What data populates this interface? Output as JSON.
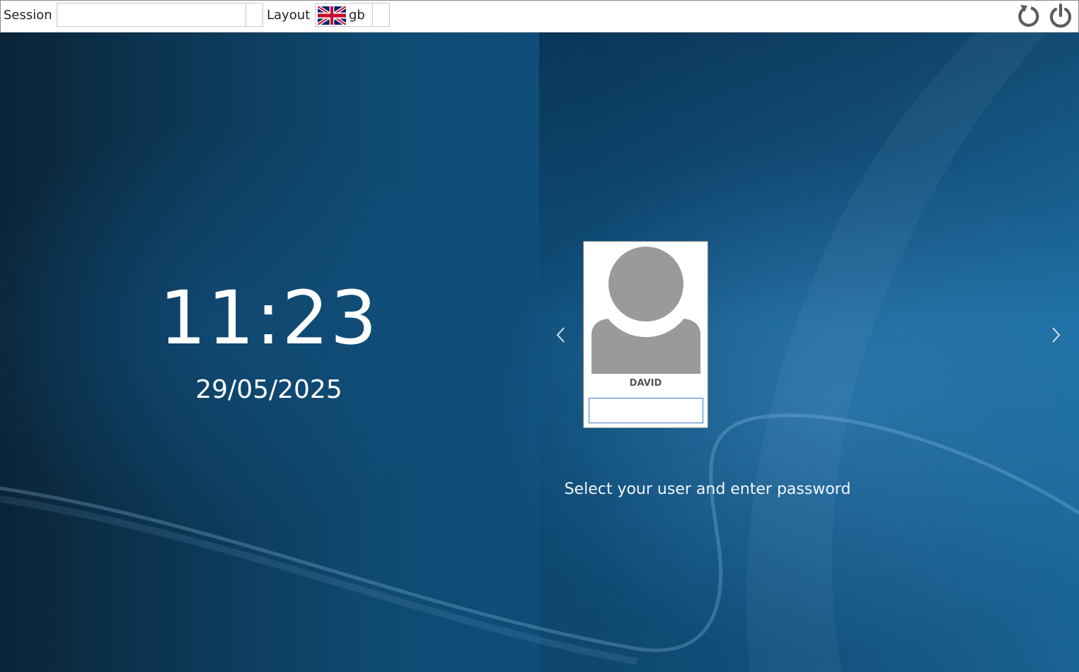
{
  "topbar": {
    "session_label": "Session",
    "session_value": "",
    "layout_label": "Layout",
    "layout_value": "gb",
    "flag_icon": "uk-flag-icon",
    "reboot_icon": "reboot-icon",
    "shutdown_icon": "power-icon"
  },
  "clock": {
    "time": "11:23",
    "date": "29/05/2025"
  },
  "user": {
    "name": "DAVID",
    "password_value": "",
    "avatar_icon": "user-avatar-icon"
  },
  "navigation": {
    "prev_icon": "chevron-left-icon",
    "next_icon": "chevron-right-icon"
  },
  "hint": "Select your user and enter password",
  "colors": {
    "background_dark": "#0a2438",
    "background_light": "#1c6ea3",
    "avatar_gray": "#9a9a9a",
    "input_border": "#3e7ac2"
  }
}
